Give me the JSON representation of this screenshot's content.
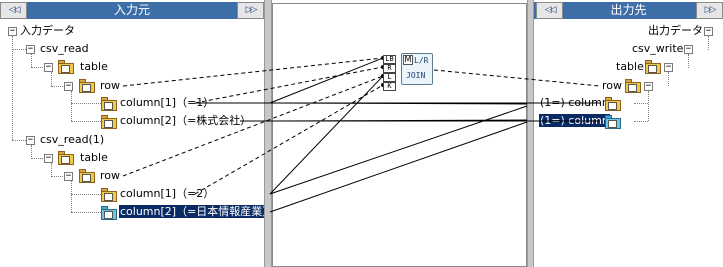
{
  "left_panel": {
    "title": "入力元",
    "prev_button": "◁◁",
    "next_button": "▷▷",
    "root_label": "入力データ",
    "tree": {
      "csv_read": "csv_read",
      "table": "table",
      "row": "row",
      "column1": "column[1]（=1）",
      "column2": "column[2]（=株式会社）",
      "csv_read1": "csv_read(1)",
      "table_b": "table",
      "row_b": "row",
      "column1_b": "column[1]（=2）",
      "column2_b": "column[2]（=日本情報産業）"
    }
  },
  "right_panel": {
    "title": "出力先",
    "prev_button": "◁◁",
    "next_button": "▷▷",
    "root_label": "出力データ",
    "tree": {
      "csv_write": "csv_write",
      "table": "table",
      "row": "row",
      "column1": "(1=) column",
      "column2": "(1=) column"
    }
  },
  "mapping": {
    "join_label": "JOIN",
    "lr_label": "L/R",
    "m_label": "M",
    "ports": [
      "LB",
      "R",
      "L",
      "K"
    ]
  },
  "toggle_glyph": "−"
}
